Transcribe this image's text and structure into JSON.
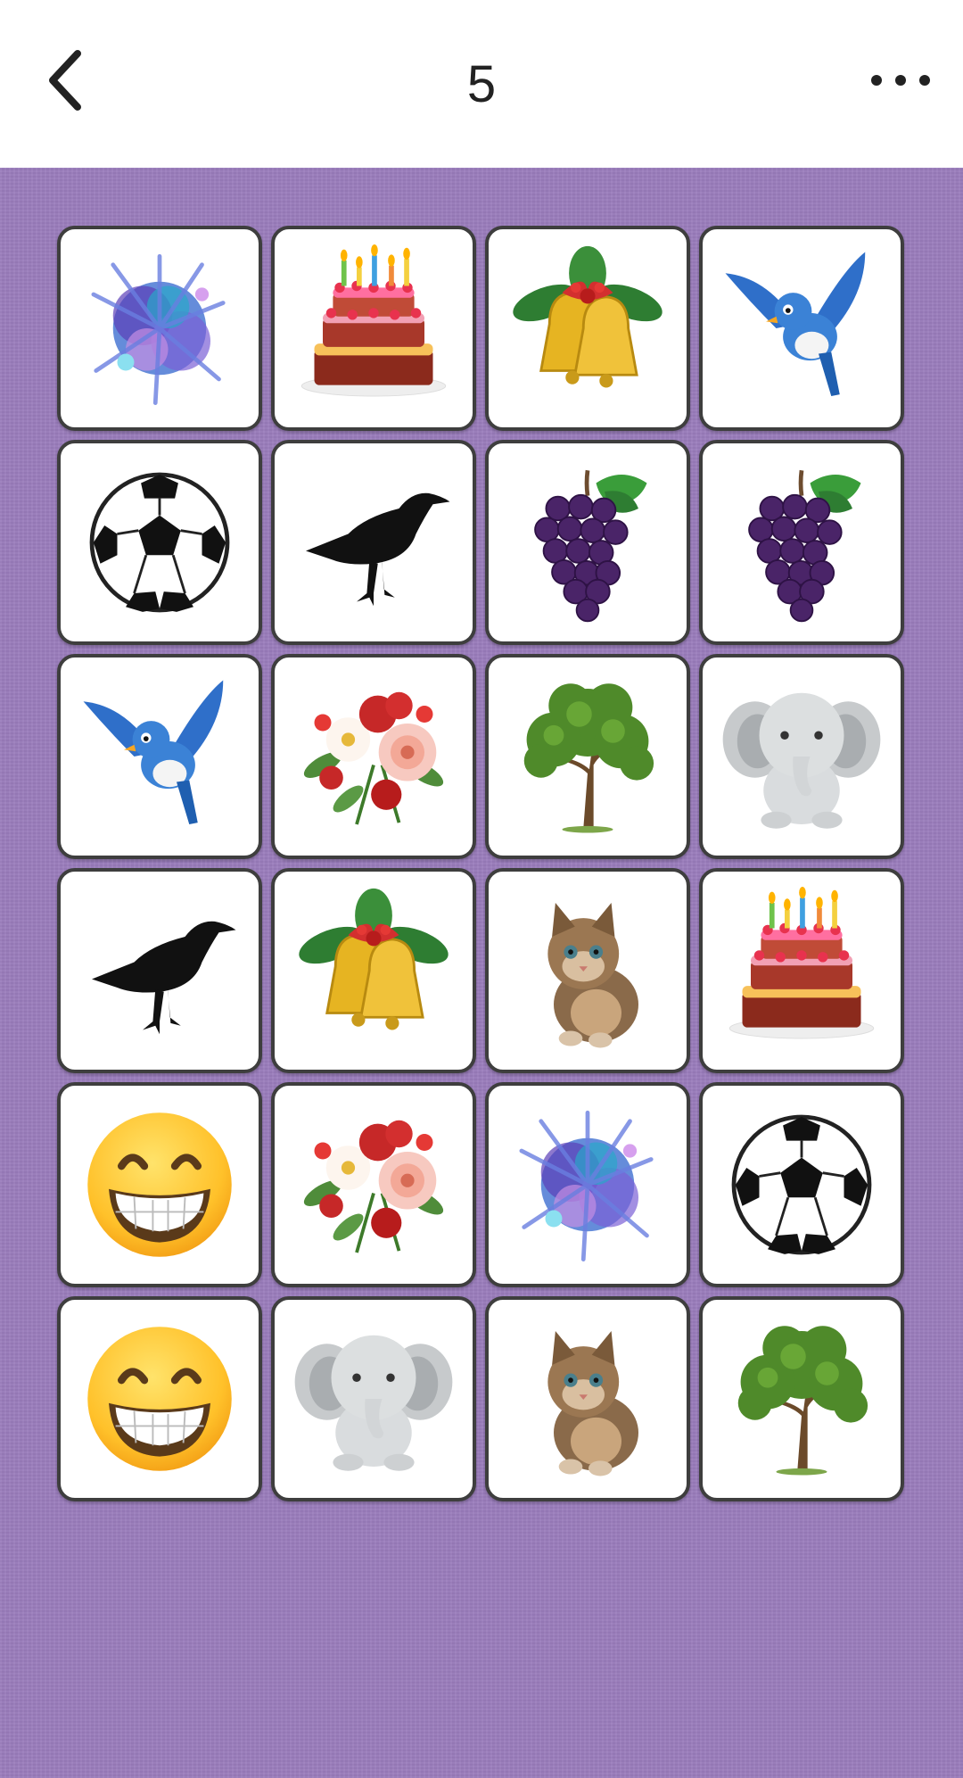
{
  "header": {
    "title": "5",
    "back_icon": "chevron-left-icon",
    "more_icon": "more-horizontal-icon"
  },
  "board": {
    "background_color": "#9a7cbc",
    "rows": [
      [
        "paint-splash-icon",
        "birthday-cake-icon",
        "christmas-bells-icon",
        "bluebird-icon"
      ],
      [
        "soccer-ball-icon",
        "crow-icon",
        "grapes-icon",
        "grapes-icon"
      ],
      [
        "bluebird-icon",
        "flower-bouquet-icon",
        "tree-icon",
        "elephant-icon"
      ],
      [
        "crow-icon",
        "christmas-bells-icon",
        "kitten-icon",
        "birthday-cake-icon"
      ],
      [
        "grinning-face-icon",
        "flower-bouquet-icon",
        "paint-splash-icon",
        "soccer-ball-icon"
      ],
      [
        "grinning-face-icon",
        "elephant-icon",
        "kitten-icon",
        "tree-icon"
      ]
    ]
  }
}
